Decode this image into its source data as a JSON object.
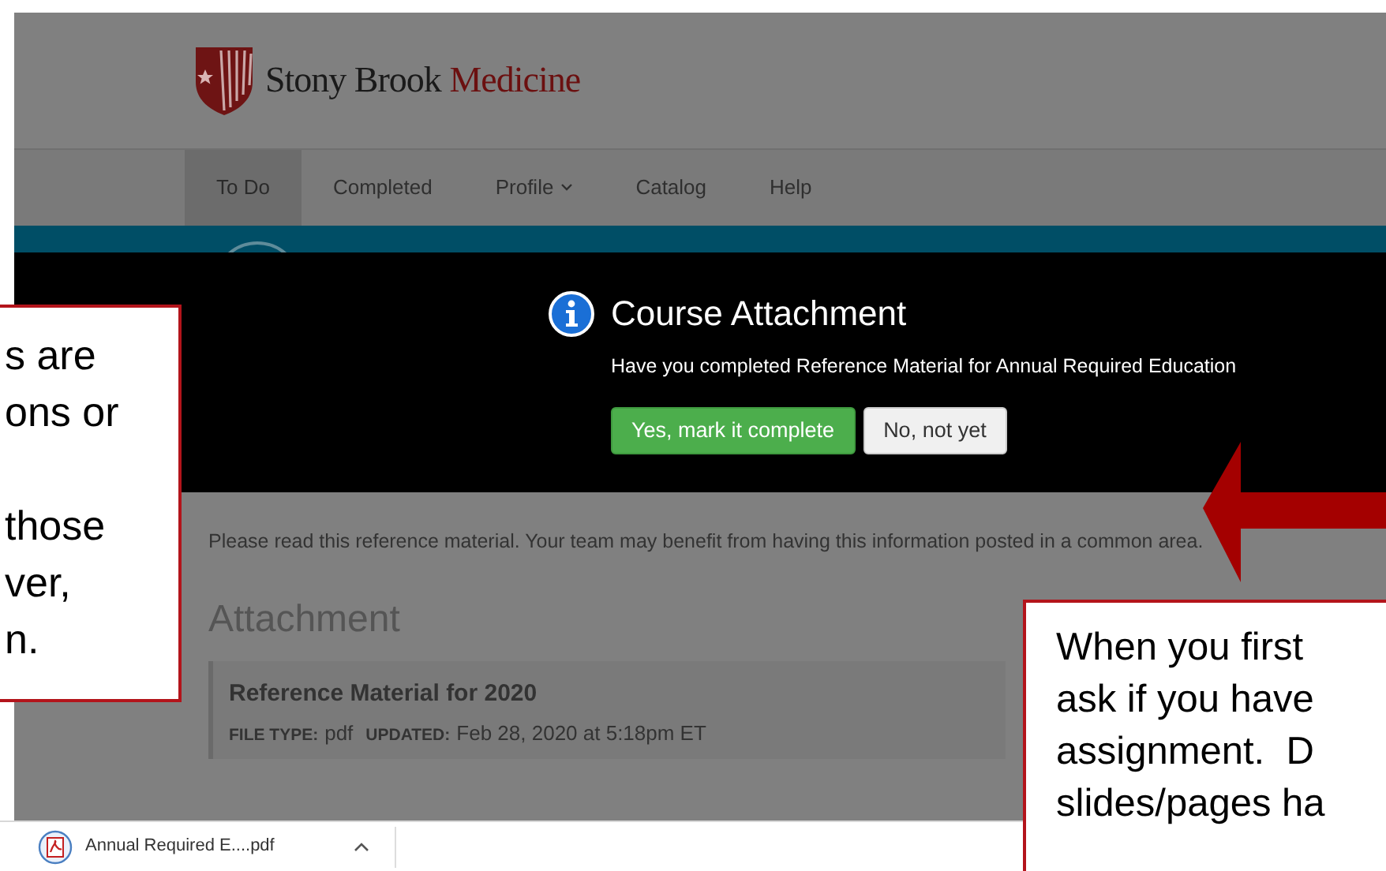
{
  "brand": {
    "name": "Stony Brook",
    "suffix": "Medicine"
  },
  "nav": [
    {
      "label": "To Do",
      "selected": true,
      "kind": "link"
    },
    {
      "label": "Completed",
      "selected": false,
      "kind": "link"
    },
    {
      "label": "Profile",
      "selected": false,
      "kind": "dropdown"
    },
    {
      "label": "Catalog",
      "selected": false,
      "kind": "link"
    },
    {
      "label": "Help",
      "selected": false,
      "kind": "link"
    }
  ],
  "dialog": {
    "title": "Course Attachment",
    "question": "Have you completed Reference Material for Annual Required Education",
    "buttons": [
      {
        "label": "Yes, mark it complete",
        "kind": "primary"
      },
      {
        "label": "No, not yet",
        "kind": "secondary"
      }
    ]
  },
  "instructions": {
    "text": "Please read this reference material. Your team may benefit from having this information posted in a common area."
  },
  "attachment": {
    "heading": "Attachment",
    "title": "Reference Material for 2020",
    "meta": [
      {
        "label": "FILE TYPE:",
        "value": "pdf"
      },
      {
        "label": "UPDATED:",
        "value": "Feb 28, 2020 at 5:18pm ET"
      }
    ]
  },
  "download_bar": {
    "file": "Annual Required E....pdf"
  },
  "callouts": [
    {
      "text": "s are\nons or\n\nthose\nver,\nn."
    },
    {
      "text": "When you first\nask if you have\nassignment.  D\nslides/pages ha"
    }
  ]
}
